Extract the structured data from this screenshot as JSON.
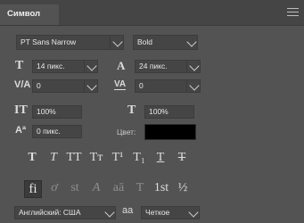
{
  "panel": {
    "tab_title": "Символ"
  },
  "font": {
    "family": "PT Sans Narrow",
    "style": "Bold"
  },
  "metrics": {
    "size": "14 пикс.",
    "leading": "24 пикс.",
    "kerning": "0",
    "tracking": "0",
    "vertical_scale": "100%",
    "horizontal_scale": "100%",
    "baseline_shift": "0 пикс.",
    "color_label": "Цвет:",
    "color_value": "#000000"
  },
  "type_styles": [
    {
      "glyph": "T",
      "name": "faux-bold"
    },
    {
      "glyph": "T",
      "name": "faux-italic"
    },
    {
      "glyph": "TT",
      "name": "all-caps"
    },
    {
      "glyph": "Tт",
      "name": "small-caps"
    },
    {
      "glyph": "T¹",
      "name": "superscript"
    },
    {
      "glyph": "T₁",
      "name": "subscript"
    },
    {
      "glyph": "T",
      "name": "underline"
    },
    {
      "glyph": "T",
      "name": "strikethrough"
    }
  ],
  "opentype": [
    {
      "glyph": "fi",
      "name": "standard-ligatures"
    },
    {
      "glyph": "ơ",
      "name": "contextual-alternates"
    },
    {
      "glyph": "st",
      "name": "discretionary-ligatures"
    },
    {
      "glyph": "A",
      "name": "swash"
    },
    {
      "glyph": "aā",
      "name": "stylistic-alternates"
    },
    {
      "glyph": "T",
      "name": "titling-alternates"
    },
    {
      "glyph": "1st",
      "name": "ordinals"
    },
    {
      "glyph": "½",
      "name": "fractions"
    }
  ],
  "language": {
    "label": "Английский: США",
    "aa_icon": "aa",
    "antialias": "Четкое"
  }
}
